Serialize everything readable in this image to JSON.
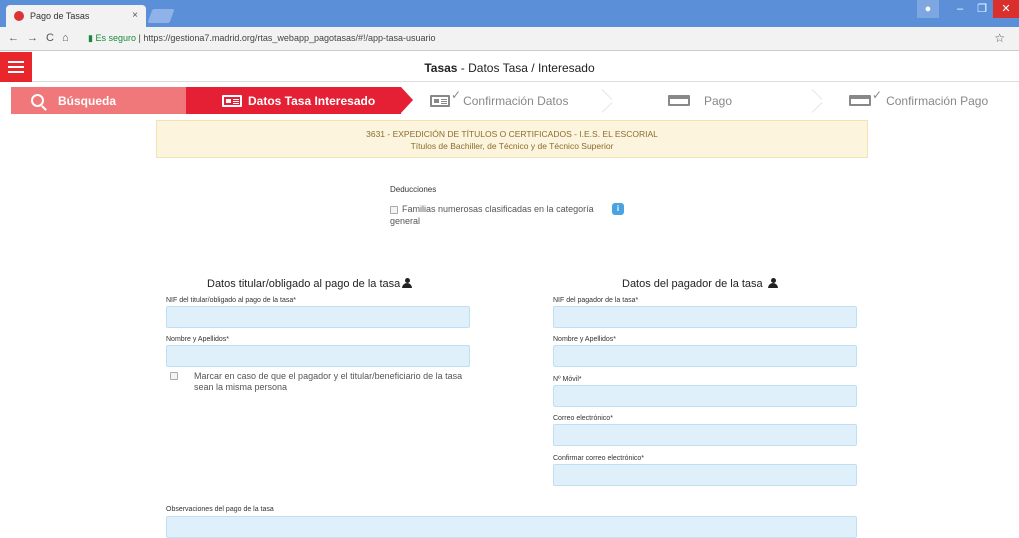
{
  "browser": {
    "tab_title": "Pago de Tasas",
    "tab_close": "×",
    "secure_label": "Es seguro",
    "url": "https://gestiona7.madrid.org/rtas_webapp_pagotasas/#!/app-tasa-usuario"
  },
  "appbar": {
    "title_bold": "Tasas",
    "title_rest": " - Datos Tasa / Interesado"
  },
  "steps": [
    {
      "label": "Búsqueda",
      "state": "done"
    },
    {
      "label": "Datos Tasa Interesado",
      "state": "active"
    },
    {
      "label": "Confirmación Datos",
      "state": "pending"
    },
    {
      "label": "Pago",
      "state": "pending"
    },
    {
      "label": "Confirmación Pago",
      "state": "pending"
    }
  ],
  "banner": {
    "line1": "3631  -  EXPEDICIÓN DE TÍTULOS O CERTIFICADOS  -  I.E.S. EL ESCORIAL",
    "line2": "Títulos de Bachiller, de Técnico y de Técnico Superior"
  },
  "deducciones": {
    "title": "Deducciones",
    "option": "Familias numerosas clasificadas en la categoría general",
    "info": "i"
  },
  "titular": {
    "title": "Datos titular/obligado al pago de la tasa",
    "nif_label": "NIF del titular/obligado al pago de la tasa*",
    "nif_value": "",
    "name_label": "Nombre y Apellidos*",
    "name_value": "",
    "same_person": "Marcar en caso de que el pagador y el titular/beneficiario de la tasa sean la misma persona"
  },
  "pagador": {
    "title": "Datos del pagador de la tasa",
    "nif_label": "NIF del pagador de la tasa*",
    "nif_value": "",
    "name_label": "Nombre y Apellidos*",
    "name_value": "",
    "movil_label": "Nº Móvil*",
    "movil_value": "",
    "email_label": "Correo electrónico*",
    "email_value": "",
    "email_confirm_label": "Confirmar correo electrónico*",
    "email_confirm_value": ""
  },
  "observaciones": {
    "label": "Observaciones del pago de la tasa",
    "value": ""
  },
  "colors": {
    "step_done": "#f0787a",
    "step_active": "#e51f34",
    "input_bg": "#dff0fa",
    "banner_bg": "#fcf4dc"
  }
}
